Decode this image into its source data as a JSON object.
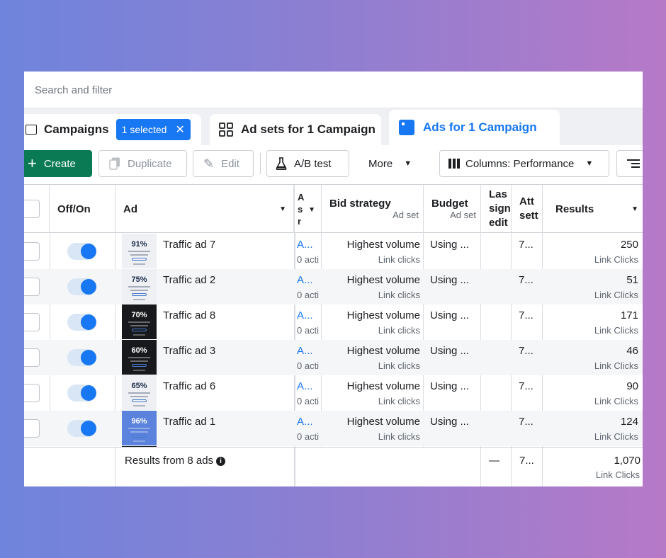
{
  "search": {
    "placeholder": "Search and filter"
  },
  "tabs": {
    "campaigns": {
      "label": "Campaigns",
      "selected_chip": "1 selected",
      "chip_close": "✕"
    },
    "adsets": {
      "label": "Ad sets for 1 Campaign"
    },
    "ads": {
      "label": "Ads for 1 Campaign"
    }
  },
  "toolbar": {
    "create": "Create",
    "duplicate": "Duplicate",
    "edit": "Edit",
    "ab_test": "A/B test",
    "more": "More",
    "columns": "Columns: Performance"
  },
  "columns": {
    "off_on": "Off/On",
    "ad": "Ad",
    "ad_set_partial": [
      "A",
      "s",
      "r"
    ],
    "bid_strategy": "Bid strategy",
    "bid_strategy_sub": "Ad set",
    "budget": "Budget",
    "budget_sub": "Ad set",
    "last_sig_edit": [
      "Las",
      "sign",
      "edit"
    ],
    "attribution": [
      "Att",
      "sett"
    ],
    "results": "Results"
  },
  "rows": [
    {
      "thumb_pct": "91%",
      "name": "Traffic ad 7",
      "adset": "A...",
      "adset_sub": "0 acti",
      "bid": "Highest volume",
      "bid_sub": "Link clicks",
      "budget": "Using ...",
      "attr": "7...",
      "results": "250",
      "results_sub": "Link Clicks"
    },
    {
      "thumb_pct": "75%",
      "name": "Traffic ad 2",
      "adset": "A...",
      "adset_sub": "0 acti",
      "bid": "Highest volume",
      "bid_sub": "Link clicks",
      "budget": "Using ...",
      "attr": "7...",
      "results": "51",
      "results_sub": "Link Clicks"
    },
    {
      "thumb_pct": "70%",
      "name": "Traffic ad 8",
      "adset": "A...",
      "adset_sub": "0 acti",
      "bid": "Highest volume",
      "bid_sub": "Link clicks",
      "budget": "Using ...",
      "attr": "7...",
      "results": "171",
      "results_sub": "Link Clicks"
    },
    {
      "thumb_pct": "60%",
      "name": "Traffic ad 3",
      "adset": "A...",
      "adset_sub": "0 acti",
      "bid": "Highest volume",
      "bid_sub": "Link clicks",
      "budget": "Using ...",
      "attr": "7...",
      "results": "46",
      "results_sub": "Link Clicks"
    },
    {
      "thumb_pct": "65%",
      "name": "Traffic ad 6",
      "adset": "A...",
      "adset_sub": "0 acti",
      "bid": "Highest volume",
      "bid_sub": "Link clicks",
      "budget": "Using ...",
      "attr": "7...",
      "results": "90",
      "results_sub": "Link Clicks"
    },
    {
      "thumb_pct": "96%",
      "name": "Traffic ad 1",
      "adset": "A...",
      "adset_sub": "0 acti",
      "bid": "Highest volume",
      "bid_sub": "Link clicks",
      "budget": "Using ...",
      "attr": "7...",
      "results": "124",
      "results_sub": "Link Clicks"
    }
  ],
  "footer": {
    "label": "Results from 8 ads",
    "info": "i",
    "last_sig": "—",
    "attr": "7...",
    "results": "1,070",
    "results_sub": "Link Clicks"
  },
  "colors": {
    "accent": "#1877f2",
    "create_green": "#0a7a55",
    "thumb_themes": [
      "light",
      "light",
      "dark",
      "dark",
      "light",
      "blue"
    ]
  }
}
